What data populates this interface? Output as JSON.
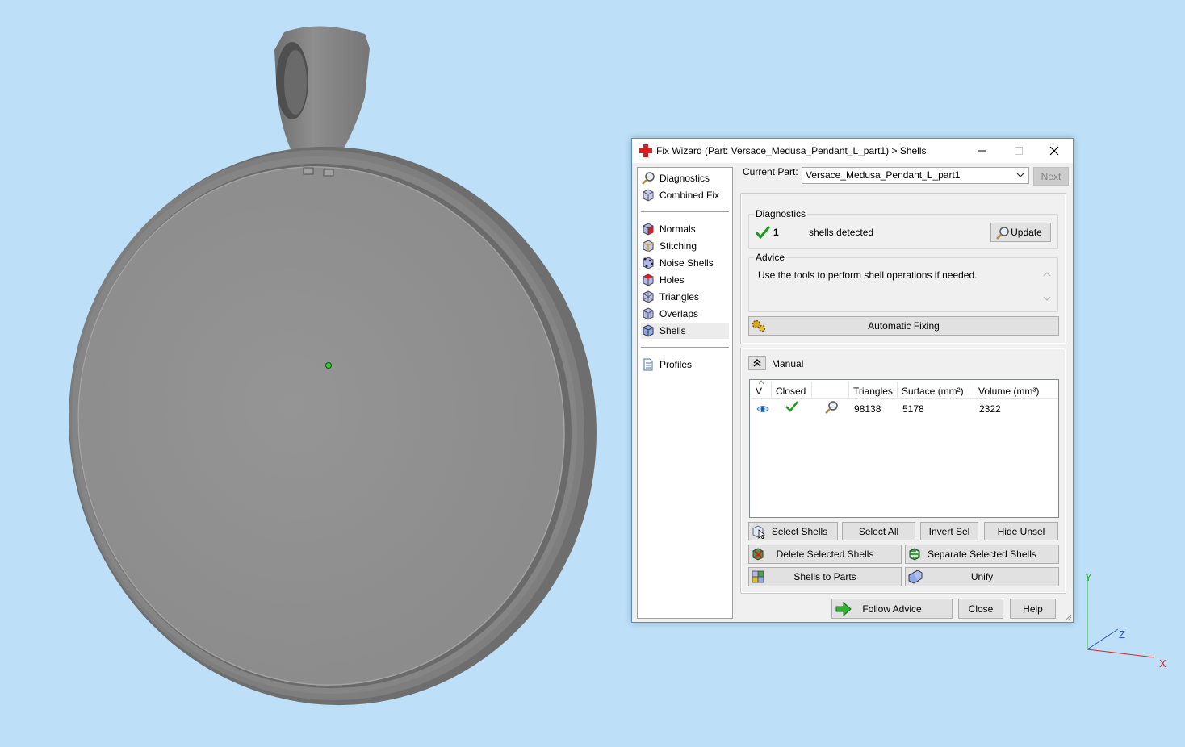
{
  "axis": {
    "x": "X",
    "y": "Y",
    "z": "Z"
  },
  "dialog": {
    "title": "Fix Wizard (Part: Versace_Medusa_Pendant_L_part1) > Shells",
    "nav": {
      "group1": [
        "Diagnostics",
        "Combined Fix"
      ],
      "group2": [
        "Normals",
        "Stitching",
        "Noise Shells",
        "Holes",
        "Triangles",
        "Overlaps",
        "Shells"
      ],
      "group3": [
        "Profiles"
      ],
      "active": "Shells"
    },
    "current_part_label": "Current Part:",
    "current_part_value": "Versace_Medusa_Pendant_L_part1",
    "next_label": "Next",
    "diagnostics": {
      "label": "Diagnostics",
      "count": "1",
      "text": "shells detected",
      "update_label": "Update"
    },
    "advice": {
      "label": "Advice",
      "text": "Use the tools to perform shell operations if needed."
    },
    "automatic_fixing_label": "Automatic Fixing",
    "manual": {
      "label": "Manual",
      "columns": [
        "V",
        "Closed",
        "",
        "Triangles",
        "Surface (mm²)",
        "Volume (mm³)"
      ],
      "rows": [
        {
          "triangles": "98138",
          "surface": "5178",
          "volume": "2322"
        }
      ],
      "buttons": {
        "select_shells": "Select Shells",
        "select_all": "Select All",
        "invert_sel": "Invert Sel",
        "hide_unsel": "Hide Unsel",
        "delete_selected": "Delete Selected Shells",
        "separate_selected": "Separate Selected Shells",
        "shells_to_parts": "Shells to Parts",
        "unify": "Unify"
      }
    },
    "footer": {
      "follow_advice": "Follow Advice",
      "close": "Close",
      "help": "Help"
    }
  },
  "colors": {
    "background": "#bddff8",
    "model": "#8f8f8f",
    "title_icon": "#d42020",
    "check": "#1a9a1a"
  }
}
